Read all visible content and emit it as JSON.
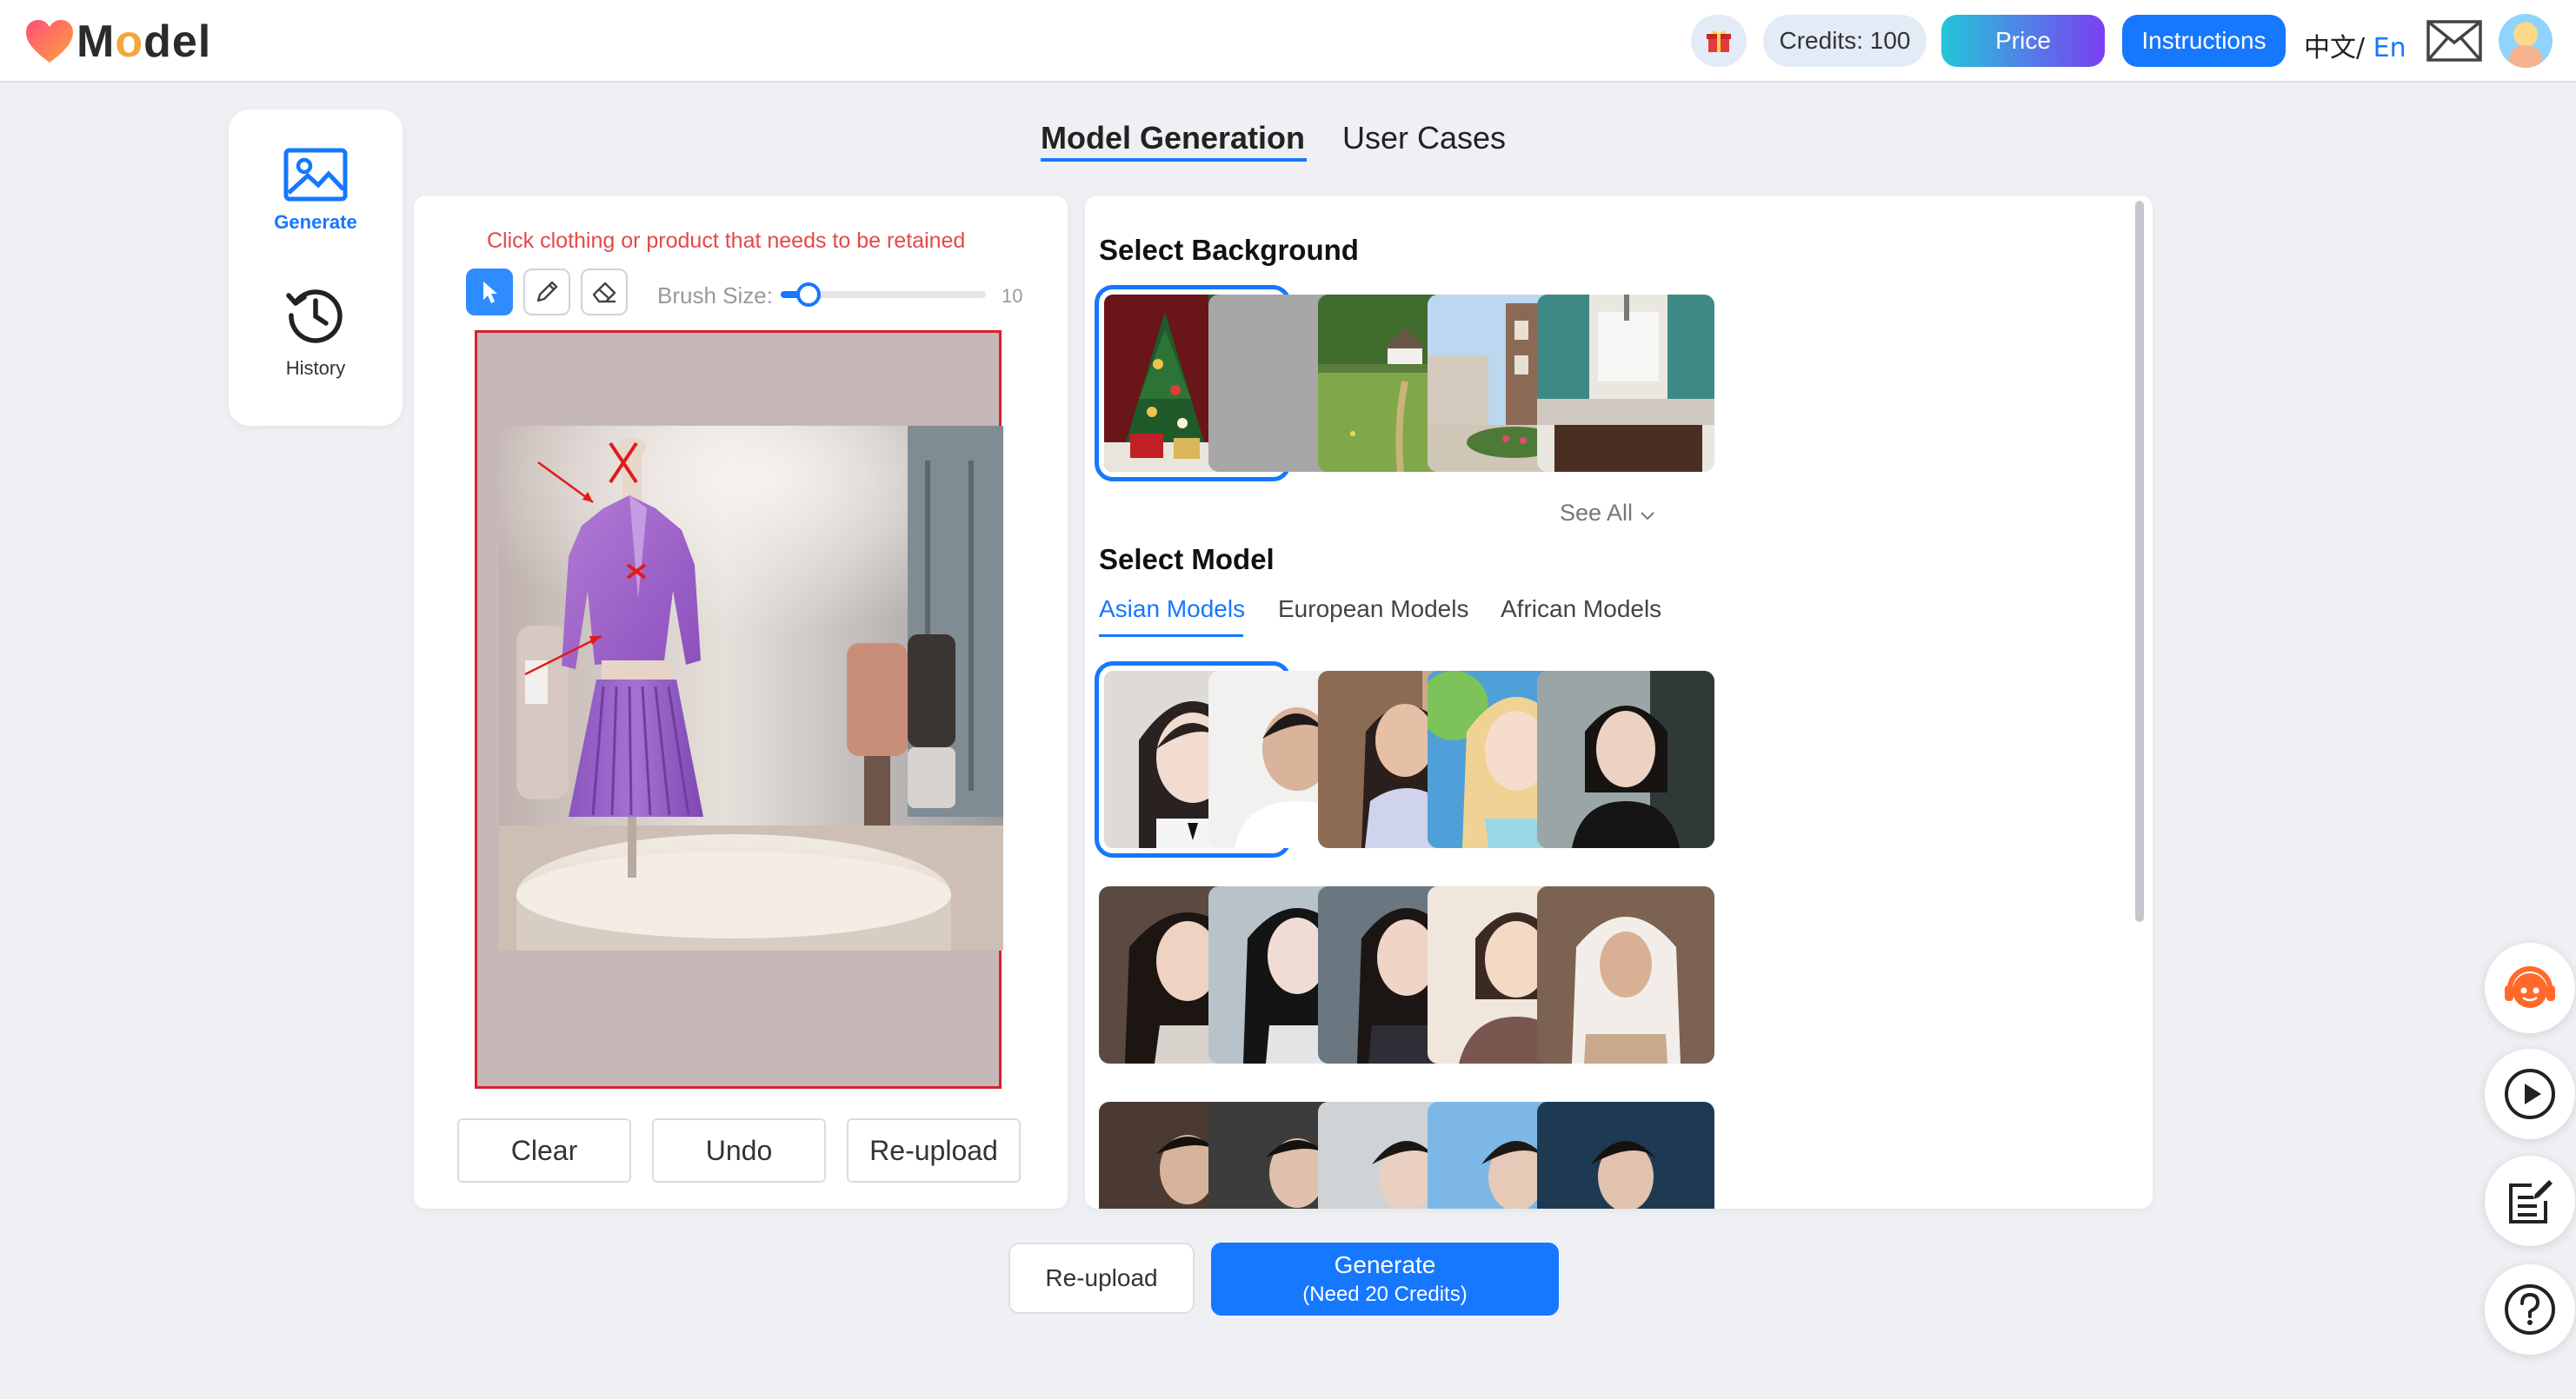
{
  "app": {
    "logo_text_a": "M",
    "logo_text_o": "o",
    "logo_text_b": "del"
  },
  "header": {
    "gift_icon": "gift-icon",
    "credits_label": "Credits: 100",
    "price_label": "Price",
    "instructions_label": "Instructions",
    "lang_zh": "中文/",
    "lang_en": " En",
    "mail_icon": "mail-icon"
  },
  "sidebar": {
    "items": [
      {
        "label": "Generate",
        "icon": "image-icon"
      },
      {
        "label": "History",
        "icon": "history-icon"
      }
    ]
  },
  "tabs": [
    {
      "label": "Model Generation",
      "active": true
    },
    {
      "label": "User Cases",
      "active": false
    }
  ],
  "editor": {
    "hint": "Click clothing or product that needs to be retained",
    "tools": [
      "pointer-icon",
      "pencil-icon",
      "eraser-icon"
    ],
    "brush_label": "Brush Size:",
    "brush_value": "10",
    "brush_max": 100,
    "buttons": {
      "clear": "Clear",
      "undo": "Undo",
      "reupload": "Re-upload"
    }
  },
  "background_section": {
    "title": "Select Background",
    "see_all": "See All",
    "thumbnails": [
      "christmas-tree",
      "plain-gray",
      "meadow-house",
      "street-plaza",
      "kitchen"
    ],
    "selected_index": 0
  },
  "model_section": {
    "title": "Select Model",
    "tabs": [
      "Asian Models",
      "European Models",
      "African Models"
    ],
    "active_tab": 0,
    "selected_index": 0
  },
  "footer": {
    "reupload_label": "Re-upload",
    "generate_label": "Generate",
    "generate_sub": "(Need 20 Credits)"
  },
  "colors": {
    "accent": "#1677ff",
    "hint_red": "#e54848",
    "frame_red": "#d8202a"
  }
}
